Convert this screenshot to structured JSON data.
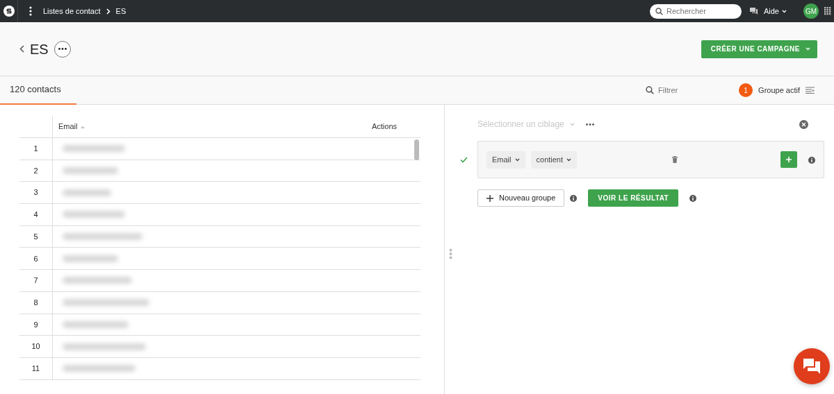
{
  "topbar": {
    "breadcrumbs": [
      "Listes de contact",
      "ES"
    ],
    "search": {
      "placeholder": "Rechercher"
    },
    "help": "Aide",
    "avatar": "GM"
  },
  "header": {
    "title": "ES",
    "create_button": "CRÉER UNE CAMPAGNE"
  },
  "tabs": [
    {
      "label": "120 contacts",
      "selected": true
    }
  ],
  "filter": {
    "placeholder": "Filtrer"
  },
  "active_group": {
    "count": "1",
    "label": "Groupe actif"
  },
  "table": {
    "columns": [
      "Email",
      "Actions"
    ],
    "rows": [
      {
        "index": "1"
      },
      {
        "index": "2"
      },
      {
        "index": "3"
      },
      {
        "index": "4"
      },
      {
        "index": "5"
      },
      {
        "index": "6"
      },
      {
        "index": "7"
      },
      {
        "index": "8"
      },
      {
        "index": "9"
      },
      {
        "index": "10"
      },
      {
        "index": "11"
      }
    ]
  },
  "targeting": {
    "placeholder": "Sélectionner un ciblage",
    "condition": {
      "valid": true,
      "field": "Email",
      "operator": "contient"
    },
    "new_group_button": "Nouveau groupe",
    "result_button": "VOIR LE RÉSULTAT"
  }
}
